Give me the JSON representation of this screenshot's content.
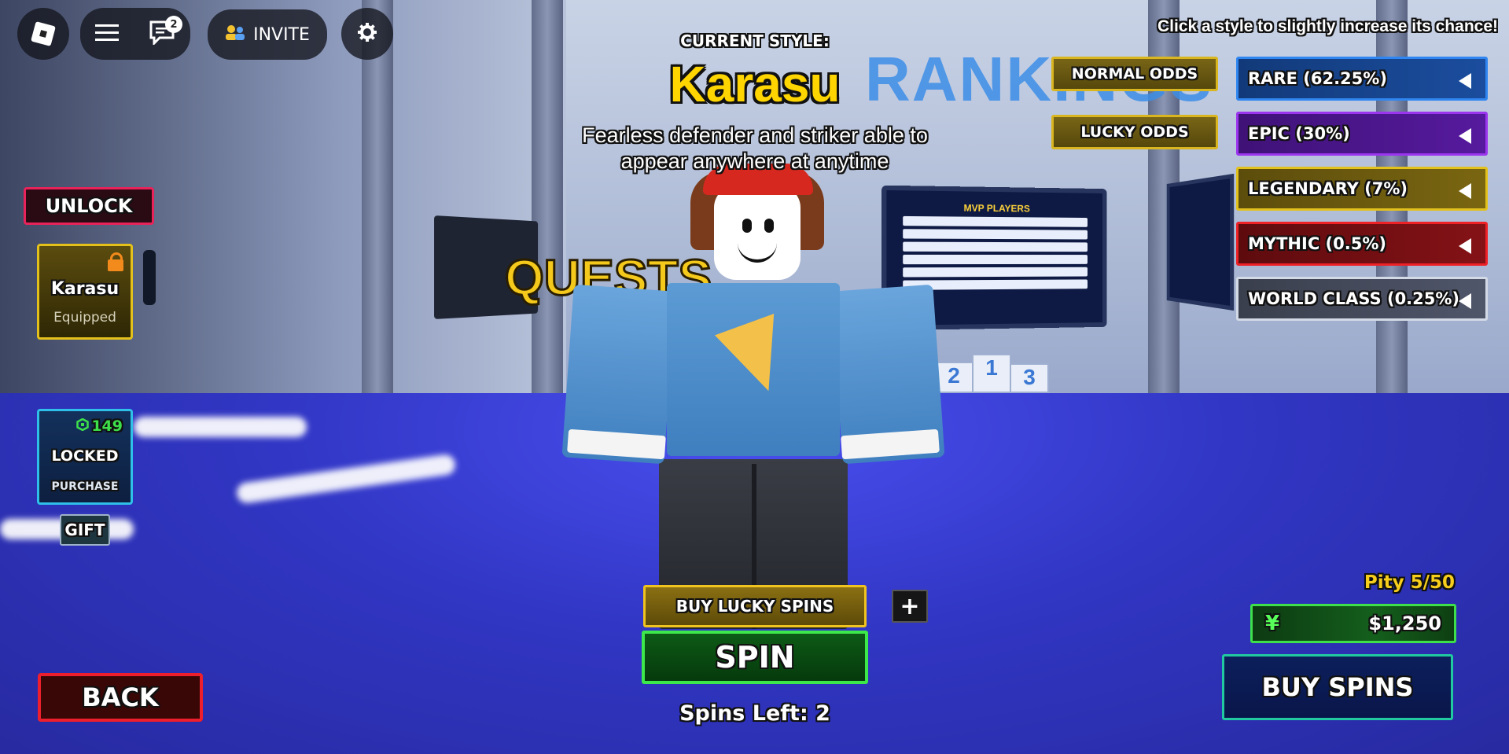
{
  "topbar": {
    "menu_icon": "hamburger-icon",
    "chat_icon": "chat-icon",
    "chat_badge": "2",
    "invite_label": "INVITE",
    "settings_icon": "gear-icon"
  },
  "hint_text": "Click a style to slightly increase its chance!",
  "current_style": {
    "label": "CURRENT STYLE:",
    "name": "Karasu",
    "description": "Fearless defender and striker able to appear anywhere at anytime"
  },
  "odds_buttons": {
    "normal": "NORMAL ODDS",
    "lucky": "LUCKY ODDS"
  },
  "rarities": [
    {
      "label": "RARE (62.25%)",
      "color": "#1f6fd6"
    },
    {
      "label": "EPIC (30%)",
      "color": "#8b22d6"
    },
    {
      "label": "LEGENDARY (7%)",
      "color": "#d6b51a"
    },
    {
      "label": "MYTHIC (0.5%)",
      "color": "#d61c22"
    },
    {
      "label": "WORLD CLASS (0.25%)",
      "color": "#cfd6e3"
    }
  ],
  "left_panel": {
    "unlock_label": "UNLOCK",
    "slot1": {
      "name": "Karasu",
      "status": "Equipped"
    },
    "slot2": {
      "price": "149",
      "title": "LOCKED",
      "action": "PURCHASE"
    },
    "gift_label": "GIFT"
  },
  "scene": {
    "rankings_sign": "RANKINGS",
    "quests_sign": "QUESTS",
    "mvp_title": "MVP PLAYERS"
  },
  "bottom": {
    "buy_lucky_label": "BUY LUCKY SPINS",
    "plus_label": "+",
    "spin_label": "SPIN",
    "spins_left": "Spins Left: 2",
    "back_label": "BACK"
  },
  "right_bottom": {
    "pity": "Pity 5/50",
    "currency_symbol": "¥",
    "money": "$1,250",
    "buy_spins_label": "BUY SPINS"
  }
}
